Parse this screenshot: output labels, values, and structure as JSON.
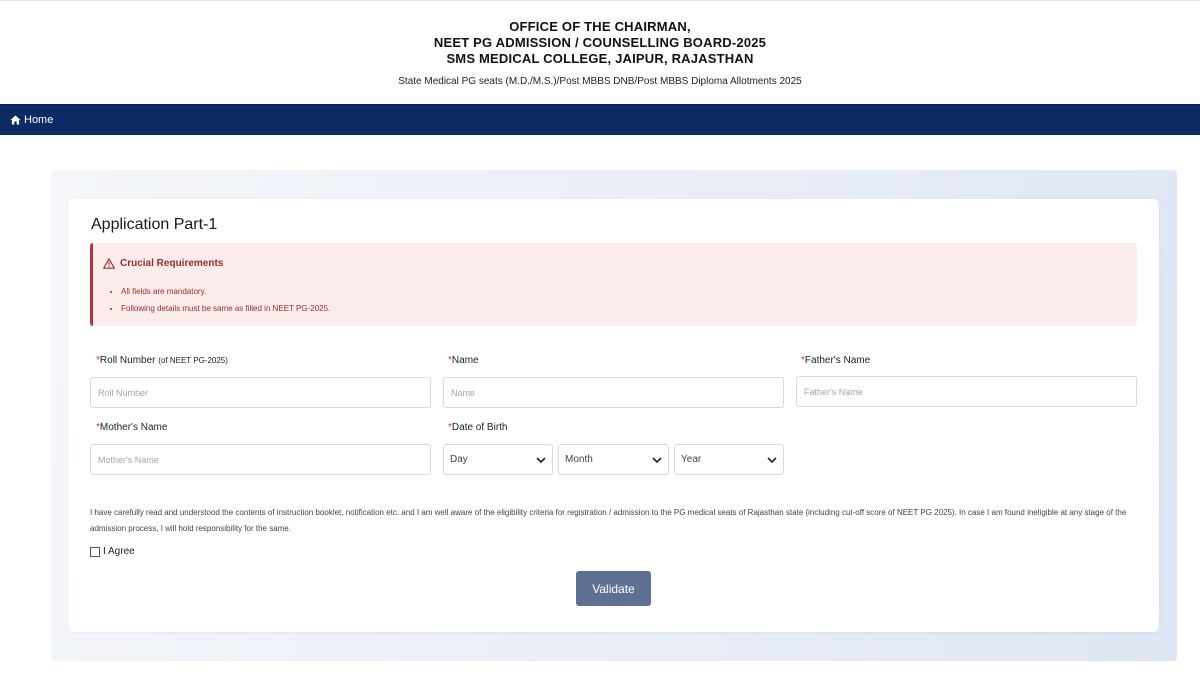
{
  "header": {
    "line1": "OFFICE OF THE CHAIRMAN,",
    "line2": "NEET PG ADMISSION / COUNSELLING BOARD-2025",
    "line3": "SMS MEDICAL COLLEGE, JAIPUR, RAJASTHAN",
    "subtitle": "State Medical PG seats (M.D./M.S.)/Post MBBS DNB/Post MBBS Diploma Allotments 2025"
  },
  "nav": {
    "home_icon": "home-icon",
    "home_label": "Home"
  },
  "form": {
    "title": "Application Part-1",
    "alert": {
      "icon": "warning-icon",
      "heading": "Crucial Requirements",
      "items": [
        "All fields are mandatory.",
        "Following details must be same as filled in NEET PG-2025."
      ]
    },
    "fields": {
      "roll_number": {
        "required_mark": "*",
        "label": "Roll Number",
        "hint": "(of NEET PG-2025)",
        "placeholder": "Roll Number"
      },
      "name": {
        "required_mark": "*",
        "label": "Name",
        "placeholder": "Name"
      },
      "father_name": {
        "required_mark": "*",
        "label": "Father's Name",
        "placeholder": "Father's Name"
      },
      "mother_name": {
        "required_mark": "*",
        "label": "Mother's Name",
        "placeholder": "Mother's Name"
      },
      "dob": {
        "required_mark": "*",
        "label": "Date of Birth",
        "day": "Day",
        "month": "Month",
        "year": "Year"
      }
    },
    "declaration": "I have carefully read and understood the contents of instruction booklet, notification etc. and I am well aware of the eligibility criteria for registration / admission to the PG medical seats of Rajasthan state (including cut-off score of NEET PG 2025). In case I am found ineligible at any stage of the admission process, I will hold responsibility for the same.",
    "agree_label": "I Agree",
    "agree_checked": false,
    "validate_label": "Validate"
  },
  "colors": {
    "navbar": "#0c2a64",
    "alert_bg": "#fcecec",
    "alert_text": "#9b2a30",
    "button": "#5f7193"
  }
}
